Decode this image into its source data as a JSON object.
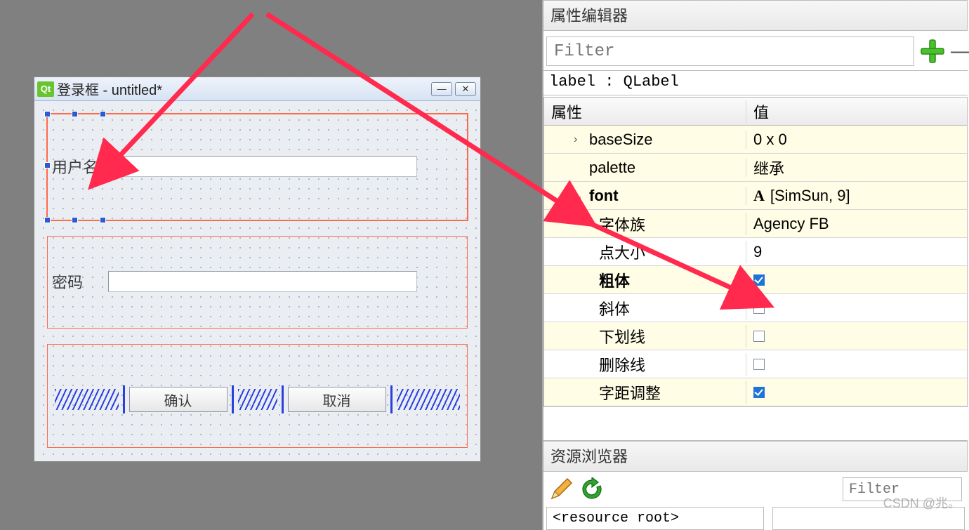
{
  "designer_window": {
    "logo_text": "Qt",
    "title": "登录框 - untitled*",
    "minimize_glyph": "—",
    "close_glyph": "✕",
    "rows": {
      "username_label": "用户名",
      "password_label": "密码"
    },
    "buttons": {
      "ok": "确认",
      "cancel": "取消"
    }
  },
  "property_editor": {
    "header": "属性编辑器",
    "filter_placeholder": "Filter",
    "class_line": "label : QLabel",
    "columns": {
      "prop": "属性",
      "value": "值"
    },
    "rows": [
      {
        "name": "baseSize",
        "value": "0 x 0",
        "tint": true,
        "level": 1,
        "expander": "›",
        "bold": false,
        "vtype": "text"
      },
      {
        "name": "palette",
        "value": "继承",
        "tint": true,
        "level": 1,
        "expander": "",
        "bold": false,
        "vtype": "text"
      },
      {
        "name": "font",
        "value": "[SimSun, 9]",
        "tint": true,
        "level": 1,
        "expander": "⌄",
        "bold": true,
        "vtype": "font"
      },
      {
        "name": "字体族",
        "value": "Agency FB",
        "tint": true,
        "level": 2,
        "bold": false,
        "vtype": "text"
      },
      {
        "name": "点大小",
        "value": "9",
        "tint": false,
        "level": 2,
        "bold": false,
        "vtype": "text"
      },
      {
        "name": "粗体",
        "value": true,
        "tint": true,
        "level": 2,
        "bold": true,
        "vtype": "check"
      },
      {
        "name": "斜体",
        "value": false,
        "tint": false,
        "level": 2,
        "bold": false,
        "vtype": "check"
      },
      {
        "name": "下划线",
        "value": false,
        "tint": true,
        "level": 2,
        "bold": false,
        "vtype": "check"
      },
      {
        "name": "删除线",
        "value": false,
        "tint": false,
        "level": 2,
        "bold": false,
        "vtype": "check"
      },
      {
        "name": "字距调整",
        "value": true,
        "tint": true,
        "level": 2,
        "bold": false,
        "vtype": "check"
      }
    ]
  },
  "resource_browser": {
    "header": "资源浏览器",
    "filter_placeholder": "Filter",
    "root_label": "<resource root>"
  },
  "watermark": "CSDN @兆。"
}
